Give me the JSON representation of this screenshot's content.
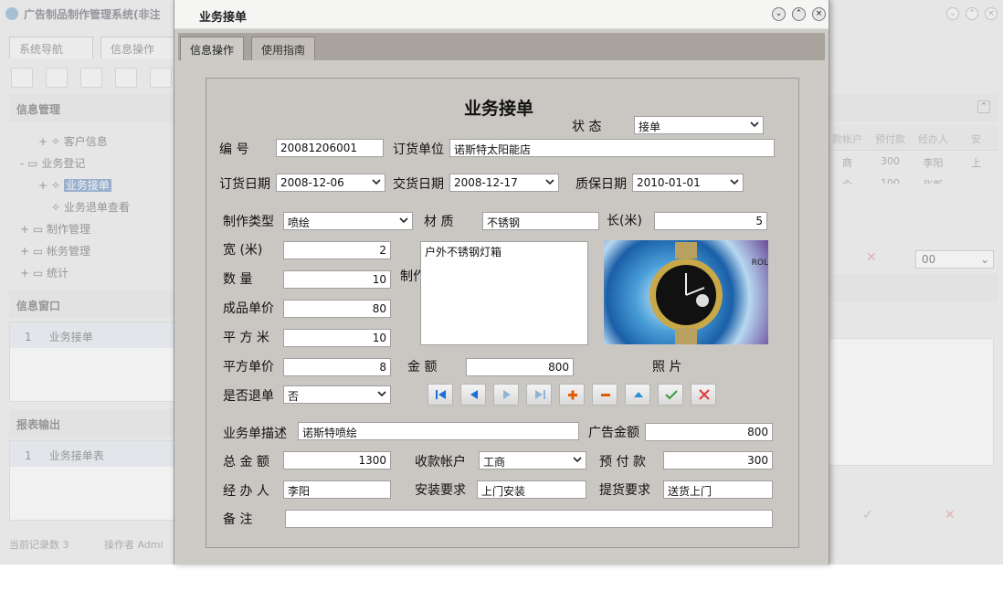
{
  "app": {
    "title": "广告制品制作管理系统(非注"
  },
  "background": {
    "tabs": [
      "系统导航",
      "信息操作"
    ],
    "sections": {
      "info_mgmt": "信息管理",
      "info_window": "信息窗口",
      "report_output": "报表输出"
    },
    "tree": [
      "客户信息",
      "业务登记",
      "业务接单",
      "业务退单查看",
      "制作管理",
      "帐务管理",
      "统计"
    ],
    "info_window_rows": [
      {
        "num": "1",
        "label": "业务接单"
      }
    ],
    "report_rows": [
      {
        "num": "1",
        "label": "业务接单表"
      }
    ],
    "status": {
      "records": "当前记录数 3",
      "operator": "操作者 Admi"
    },
    "grid": {
      "headers": [
        "款帐户",
        "预付款",
        "经办人",
        "安"
      ],
      "rows": [
        [
          "商",
          "300",
          "李阳",
          "上"
        ],
        [
          "企",
          "100",
          "张新",
          ""
        ]
      ],
      "select_value": "00"
    }
  },
  "dialog": {
    "title": "业务接单",
    "tabs": {
      "active": "信息操作",
      "inactive": "使用指南"
    },
    "form": {
      "heading": "业务接单",
      "status": {
        "label": "状 态",
        "value": "接单"
      },
      "number": {
        "label": "编 号",
        "value": "20081206001"
      },
      "customer": {
        "label": "订货单位",
        "value": "诺斯特太阳能店"
      },
      "order_date": {
        "label": "订货日期",
        "value": "2008-12-06"
      },
      "delivery_date": {
        "label": "交货日期",
        "value": "2008-12-17"
      },
      "warranty_date": {
        "label": "质保日期",
        "value": "2010-01-01"
      },
      "make_type": {
        "label": "制作类型",
        "value": "喷绘"
      },
      "material": {
        "label": "材 质",
        "value": "不锈钢"
      },
      "length": {
        "label": "长(米)",
        "value": "5"
      },
      "width": {
        "label": "宽 (米)",
        "value": "2"
      },
      "quantity": {
        "label": "数 量",
        "value": "10"
      },
      "unit_price": {
        "label": "成品单价",
        "value": "80"
      },
      "square_meters": {
        "label": "平 方 米",
        "value": "10"
      },
      "sqm_price": {
        "label": "平方单价",
        "value": "8"
      },
      "amount": {
        "label": "金 额",
        "value": "800"
      },
      "is_returned": {
        "label": "是否退单",
        "value": "否"
      },
      "production_label": "制作",
      "production_text": "户外不锈钢灯箱",
      "photo_label": "照 片",
      "photo_text": "ROL",
      "description": {
        "label": "业务单描述",
        "value": "诺斯特喷绘"
      },
      "ad_amount": {
        "label": "广告金额",
        "value": "800"
      },
      "total": {
        "label": "总 金 额",
        "value": "1300"
      },
      "account": {
        "label": "收款帐户",
        "value": "工商"
      },
      "prepay": {
        "label": "预 付 款",
        "value": "300"
      },
      "handler": {
        "label": "经 办 人",
        "value": "李阳"
      },
      "install": {
        "label": "安装要求",
        "value": "上门安装"
      },
      "pickup": {
        "label": "提货要求",
        "value": "送货上门"
      },
      "remarks": {
        "label": "备 注",
        "value": ""
      }
    },
    "colors": {
      "first": "#1a6fd8",
      "add": "#e05a00",
      "delete": "#e05a00",
      "up": "#2a8fd0",
      "confirm": "#3a9a3a",
      "cancel": "#e03a3a"
    }
  }
}
